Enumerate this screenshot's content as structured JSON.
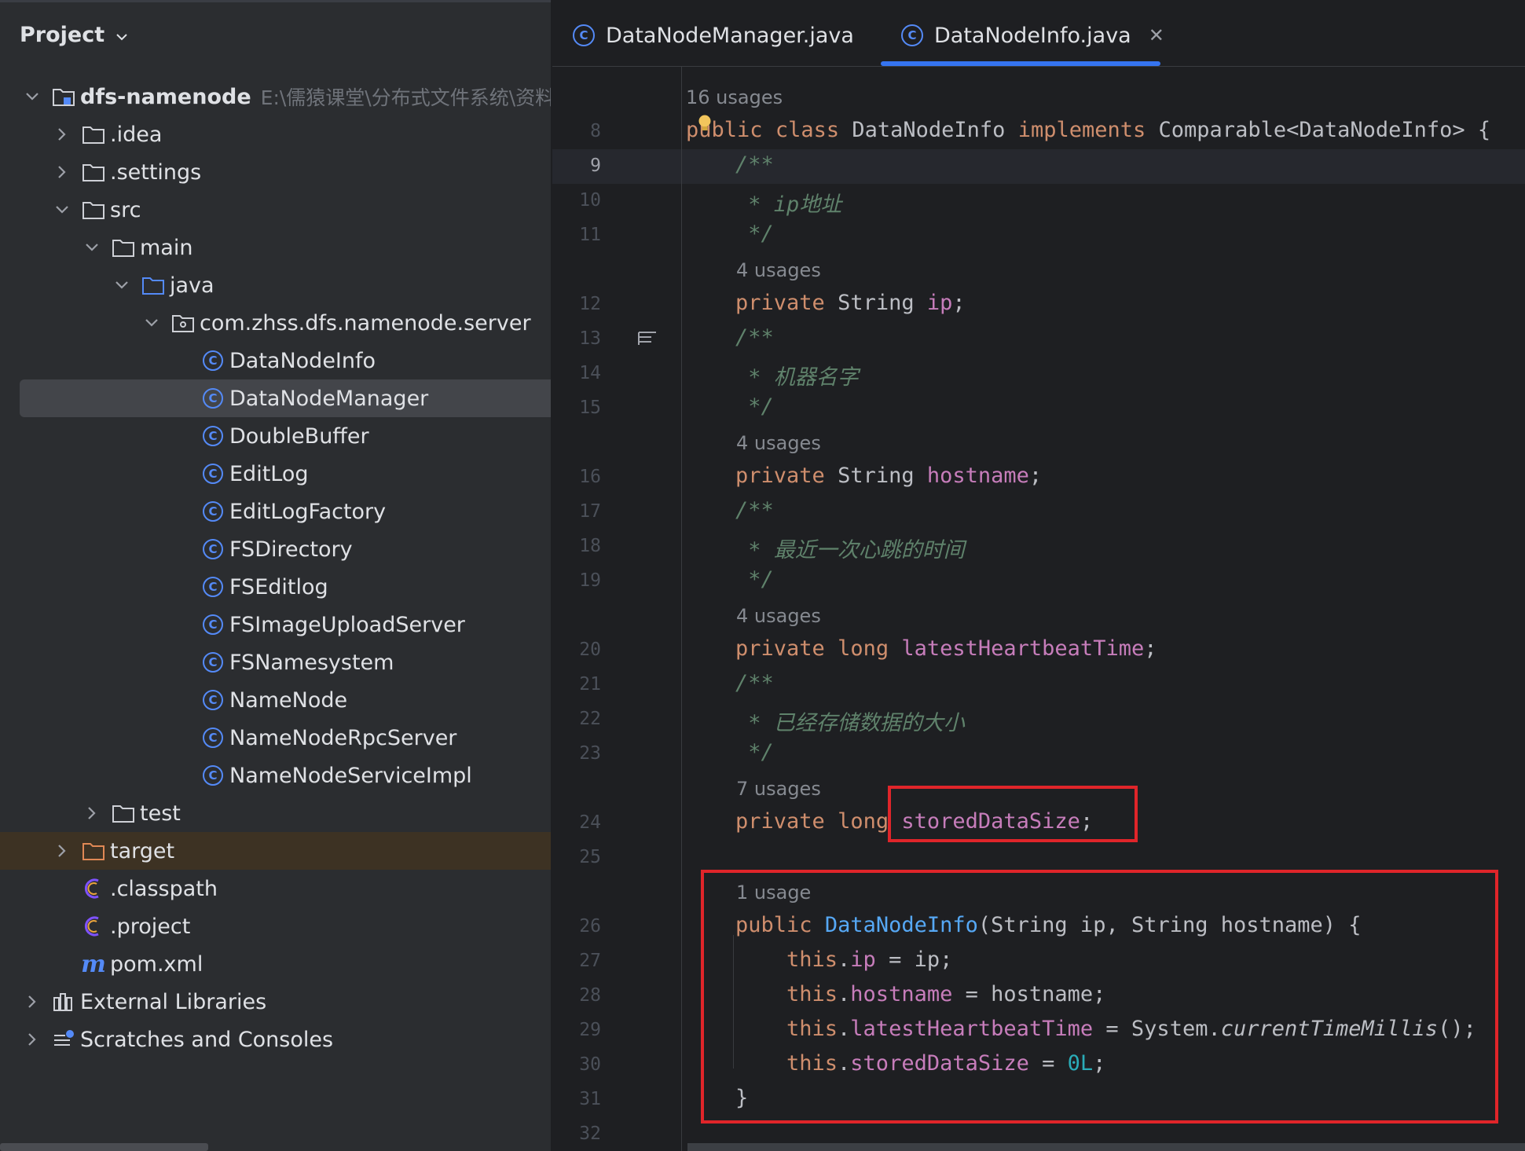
{
  "project_panel": {
    "title": "Project",
    "tree": [
      {
        "label": "dfs-namenode",
        "hint": "E:\\儒猿课堂\\分布式文件系统\\资料"
      },
      {
        "label": ".idea"
      },
      {
        "label": ".settings"
      },
      {
        "label": "src"
      },
      {
        "label": "main"
      },
      {
        "label": "java"
      },
      {
        "label": "com.zhss.dfs.namenode.server"
      },
      {
        "label": "DataNodeInfo"
      },
      {
        "label": "DataNodeManager"
      },
      {
        "label": "DoubleBuffer"
      },
      {
        "label": "EditLog"
      },
      {
        "label": "EditLogFactory"
      },
      {
        "label": "FSDirectory"
      },
      {
        "label": "FSEditlog"
      },
      {
        "label": "FSImageUploadServer"
      },
      {
        "label": "FSNamesystem"
      },
      {
        "label": "NameNode"
      },
      {
        "label": "NameNodeRpcServer"
      },
      {
        "label": "NameNodeServiceImpl"
      },
      {
        "label": "test"
      },
      {
        "label": "target"
      },
      {
        "label": ".classpath"
      },
      {
        "label": ".project"
      },
      {
        "label": "pom.xml"
      },
      {
        "label": "External Libraries"
      },
      {
        "label": "Scratches and Consoles"
      }
    ]
  },
  "editor": {
    "tabs": [
      {
        "label": "DataNodeManager.java",
        "active": false
      },
      {
        "label": "DataNodeInfo.java",
        "active": true
      }
    ],
    "line_numbers": [
      "8",
      "9",
      "10",
      "11",
      "12",
      "13",
      "14",
      "15",
      "16",
      "17",
      "18",
      "19",
      "20",
      "21",
      "22",
      "23",
      "24",
      "25",
      "26",
      "27",
      "28",
      "29",
      "30",
      "31",
      "32"
    ],
    "usages": {
      "class": "16 usages",
      "ip": "4 usages",
      "hostname": "4 usages",
      "heartbeat": "4 usages",
      "stored": "7 usages",
      "ctor": "1 usage"
    },
    "code": {
      "l8": {
        "public": "public",
        "class": "class",
        "name": "DataNodeInfo",
        "implements": "implements",
        "rest": "Comparable<DataNodeInfo> {"
      },
      "open_comment": "/**",
      "close_comment": " */",
      "c_ip": " * ip地址",
      "c_host": " * 机器名字",
      "c_hb": " * 最近一次心跳的时间",
      "c_size": " * 已经存储数据的大小",
      "private": "private",
      "type_string": "String",
      "type_long": "long",
      "f_ip": "ip",
      "f_hostname": "hostname",
      "f_hb": "latestHeartbeatTime",
      "f_size": "storedDataSize",
      "semi": ";",
      "ctor_public": "public",
      "ctor_name": "DataNodeInfo",
      "ctor_params": "(String ip, String hostname) {",
      "this": "this",
      "dot": ".",
      "assign_ip": " = ip;",
      "assign_host": " = hostname;",
      "assign_hb_a": " = System.",
      "assign_hb_b": "currentTimeMillis",
      "assign_hb_c": "();",
      "assign_size_a": " = ",
      "zero": "0L",
      "close_brace": "}"
    }
  },
  "colors": {
    "highlight_box": "#e0252a",
    "accent": "#3574f0",
    "keyword": "#cf8e6d",
    "field": "#c77dbb",
    "comment": "#5f826b"
  }
}
